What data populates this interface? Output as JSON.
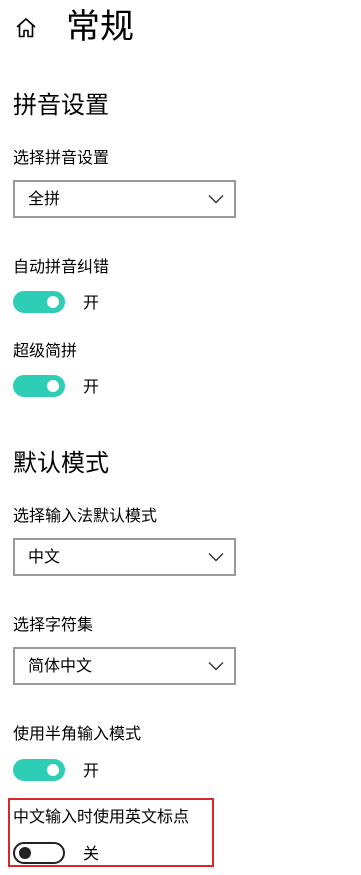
{
  "header": {
    "title": "常规",
    "home_icon": "home-icon"
  },
  "colors": {
    "toggle_on": "#2ecdb5",
    "highlight": "#d7262c",
    "dropdown_border": "#999999"
  },
  "pinyin_section": {
    "title": "拼音设置",
    "select_label": "选择拼音设置",
    "select_value": "全拼",
    "auto_correct": {
      "label": "自动拼音纠错",
      "state": "开"
    },
    "super_jianpin": {
      "label": "超级简拼",
      "state": "开"
    }
  },
  "default_mode_section": {
    "title": "默认模式",
    "input_mode_label": "选择输入法默认模式",
    "input_mode_value": "中文",
    "charset_label": "选择字符集",
    "charset_value": "简体中文",
    "half_width": {
      "label": "使用半角输入模式",
      "state": "开"
    },
    "english_punct": {
      "label": "中文输入时使用英文标点",
      "state": "关"
    }
  }
}
